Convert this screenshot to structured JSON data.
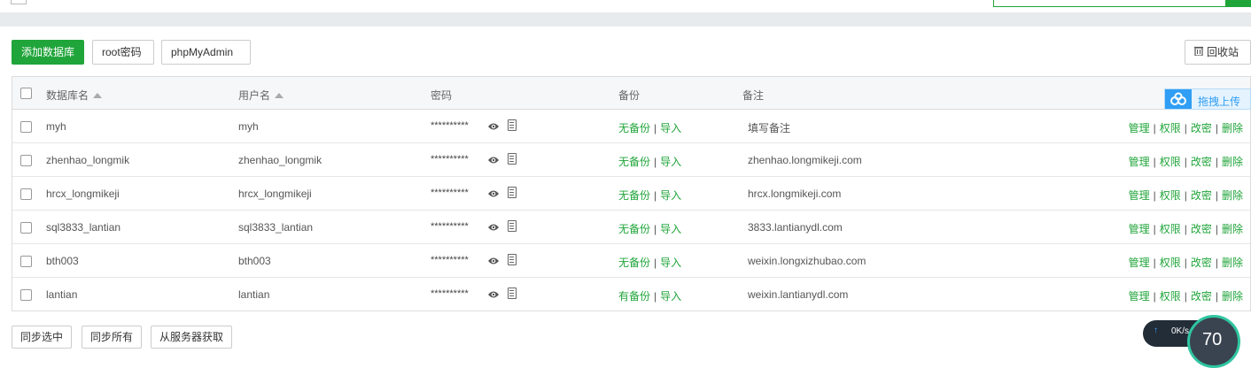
{
  "toolbar": {
    "add_label": "添加数据库",
    "root_label": "root密码",
    "pma_label": "phpMyAdmin",
    "recycle_label": "回收站"
  },
  "table": {
    "headers": {
      "name": "数据库名",
      "user": "用户名",
      "password": "密码",
      "backup": "备份",
      "remark": "备注"
    },
    "rows": [
      {
        "name": "myh",
        "user": "myh",
        "password": "**********",
        "backup": "无备份",
        "import": "导入",
        "remark": "填写备注"
      },
      {
        "name": "zhenhao_longmik",
        "user": "zhenhao_longmik",
        "password": "**********",
        "backup": "无备份",
        "import": "导入",
        "remark": "zhenhao.longmikeji.com"
      },
      {
        "name": "hrcx_longmikeji",
        "user": "hrcx_longmikeji",
        "password": "**********",
        "backup": "无备份",
        "import": "导入",
        "remark": "hrcx.longmikeji.com"
      },
      {
        "name": "sql3833_lantian",
        "user": "sql3833_lantian",
        "password": "**********",
        "backup": "无备份",
        "import": "导入",
        "remark": "3833.lantianydl.com"
      },
      {
        "name": "bth003",
        "user": "bth003",
        "password": "**********",
        "backup": "无备份",
        "import": "导入",
        "remark": "weixin.longxizhubao.com"
      },
      {
        "name": "lantian",
        "user": "lantian",
        "password": "**********",
        "backup": "有备份",
        "import": "导入",
        "remark": "weixin.lantianydl.com"
      }
    ],
    "ops": {
      "manage": "管理",
      "perm": "权限",
      "changepw": "改密",
      "delete": "删除"
    }
  },
  "upload": {
    "label": "拖拽上传"
  },
  "bottom": {
    "sync_selected": "同步选中",
    "sync_all": "同步所有",
    "from_server": "从服务器获取"
  },
  "status": {
    "speed": "0K/s",
    "gauge": "70"
  },
  "colors": {
    "accent": "#20a53a",
    "upload_blue": "#2f9ef4"
  }
}
